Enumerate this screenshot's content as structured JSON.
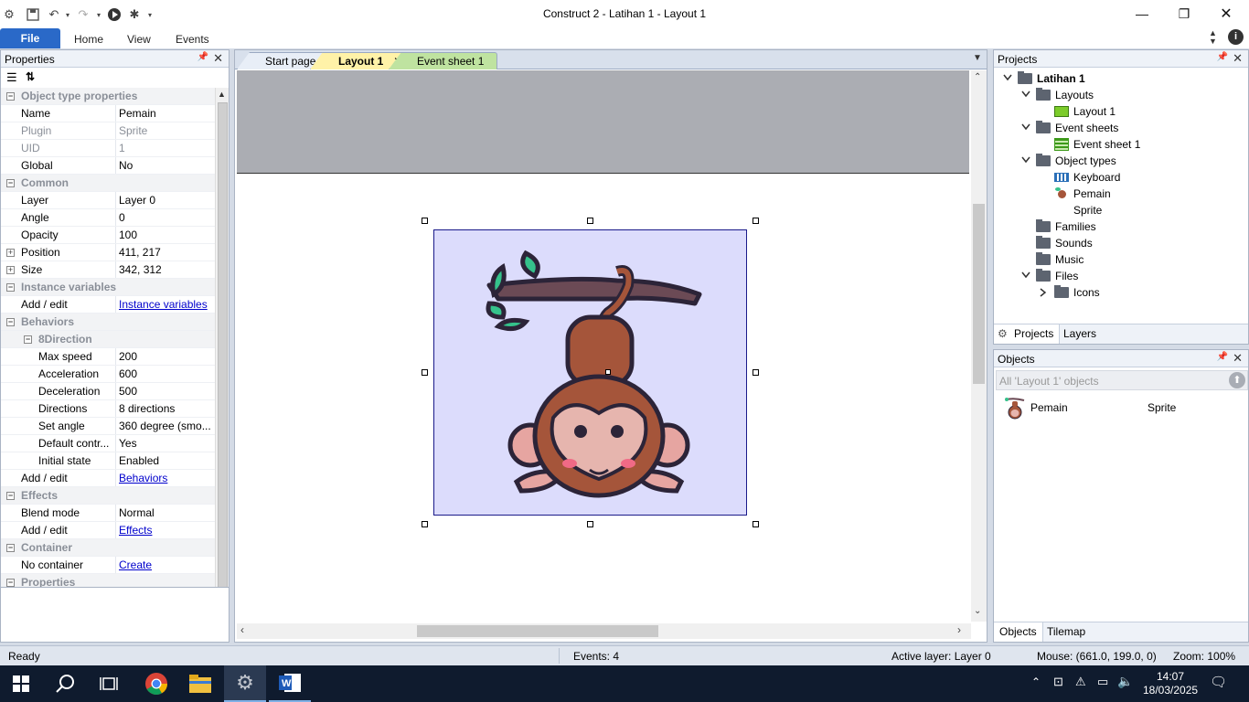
{
  "window": {
    "title": "Construct 2 - Latihan 1 - Layout 1"
  },
  "ribbon": {
    "file": "File",
    "tabs": [
      "Home",
      "View",
      "Events"
    ]
  },
  "properties": {
    "title": "Properties",
    "rows": [
      {
        "type": "sec",
        "name": "Object type properties",
        "exp": "−"
      },
      {
        "name": "Name",
        "value": "Pemain"
      },
      {
        "name": "Plugin",
        "value": "Sprite",
        "dim": true
      },
      {
        "name": "UID",
        "value": "1",
        "dim": true
      },
      {
        "name": "Global",
        "value": "No"
      },
      {
        "type": "sec",
        "name": "Common",
        "exp": "−"
      },
      {
        "name": "Layer",
        "value": "Layer 0"
      },
      {
        "name": "Angle",
        "value": "0"
      },
      {
        "name": "Opacity",
        "value": "100"
      },
      {
        "name": "Position",
        "value": "411, 217",
        "exp": "+"
      },
      {
        "name": "Size",
        "value": "342, 312",
        "exp": "+"
      },
      {
        "type": "sec",
        "name": "Instance variables",
        "exp": "−"
      },
      {
        "name": "Add / edit",
        "value": "Instance variables",
        "link": true
      },
      {
        "type": "sec",
        "name": "Behaviors",
        "exp": "−"
      },
      {
        "type": "sec2",
        "name": "8Direction",
        "exp": "−"
      },
      {
        "name": "Max speed",
        "value": "200",
        "indent": true
      },
      {
        "name": "Acceleration",
        "value": "600",
        "indent": true
      },
      {
        "name": "Deceleration",
        "value": "500",
        "indent": true
      },
      {
        "name": "Directions",
        "value": "8 directions",
        "indent": true
      },
      {
        "name": "Set angle",
        "value": "360 degree (smo...",
        "indent": true
      },
      {
        "name": "Default contr...",
        "value": "Yes",
        "indent": true
      },
      {
        "name": "Initial state",
        "value": "Enabled",
        "indent": true
      },
      {
        "name": "Add / edit",
        "value": "Behaviors",
        "link": true
      },
      {
        "type": "sec",
        "name": "Effects",
        "exp": "−"
      },
      {
        "name": "Blend mode",
        "value": "Normal"
      },
      {
        "name": "Add / edit",
        "value": "Effects",
        "link": true
      },
      {
        "type": "sec",
        "name": "Container",
        "exp": "−"
      },
      {
        "name": "No container",
        "value": "Create",
        "link": true
      },
      {
        "type": "sec",
        "name": "Properties",
        "exp": "−"
      }
    ]
  },
  "doc_tabs": [
    "Start page",
    "Layout 1",
    "Event sheet 1"
  ],
  "projects": {
    "title": "Projects",
    "tree": [
      {
        "label": "Latihan 1",
        "level": 0,
        "caret": "v",
        "icon": "folder",
        "bold": true
      },
      {
        "label": "Layouts",
        "level": 1,
        "caret": "v",
        "icon": "folder"
      },
      {
        "label": "Layout 1",
        "level": 2,
        "icon": "layout"
      },
      {
        "label": "Event sheets",
        "level": 1,
        "caret": "v",
        "icon": "folder"
      },
      {
        "label": "Event sheet 1",
        "level": 2,
        "icon": "eventsheet"
      },
      {
        "label": "Object types",
        "level": 1,
        "caret": "v",
        "icon": "folder"
      },
      {
        "label": "Keyboard",
        "level": 2,
        "icon": "keyboard"
      },
      {
        "label": "Pemain",
        "level": 2,
        "icon": "monkey"
      },
      {
        "label": "Sprite",
        "level": 2,
        "icon": "none"
      },
      {
        "label": "Families",
        "level": 1,
        "icon": "folder"
      },
      {
        "label": "Sounds",
        "level": 1,
        "icon": "folder"
      },
      {
        "label": "Music",
        "level": 1,
        "icon": "folder"
      },
      {
        "label": "Files",
        "level": 1,
        "caret": "v",
        "icon": "folder"
      },
      {
        "label": "Icons",
        "level": 2,
        "caret": ">",
        "icon": "folder"
      }
    ],
    "tabs": [
      "Projects",
      "Layers"
    ]
  },
  "objects": {
    "title": "Objects",
    "filter_placeholder": "All 'Layout 1' objects",
    "items": [
      {
        "name": "Pemain",
        "type": "Sprite"
      }
    ],
    "tabs": [
      "Objects",
      "Tilemap"
    ]
  },
  "status": {
    "ready": "Ready",
    "events": "Events: 4",
    "layer": "Active layer: Layer 0",
    "mouse": "Mouse: (661.0, 199.0, 0)",
    "zoom": "Zoom: 100%"
  },
  "taskbar": {
    "time": "14:07",
    "date": "18/03/2025"
  }
}
